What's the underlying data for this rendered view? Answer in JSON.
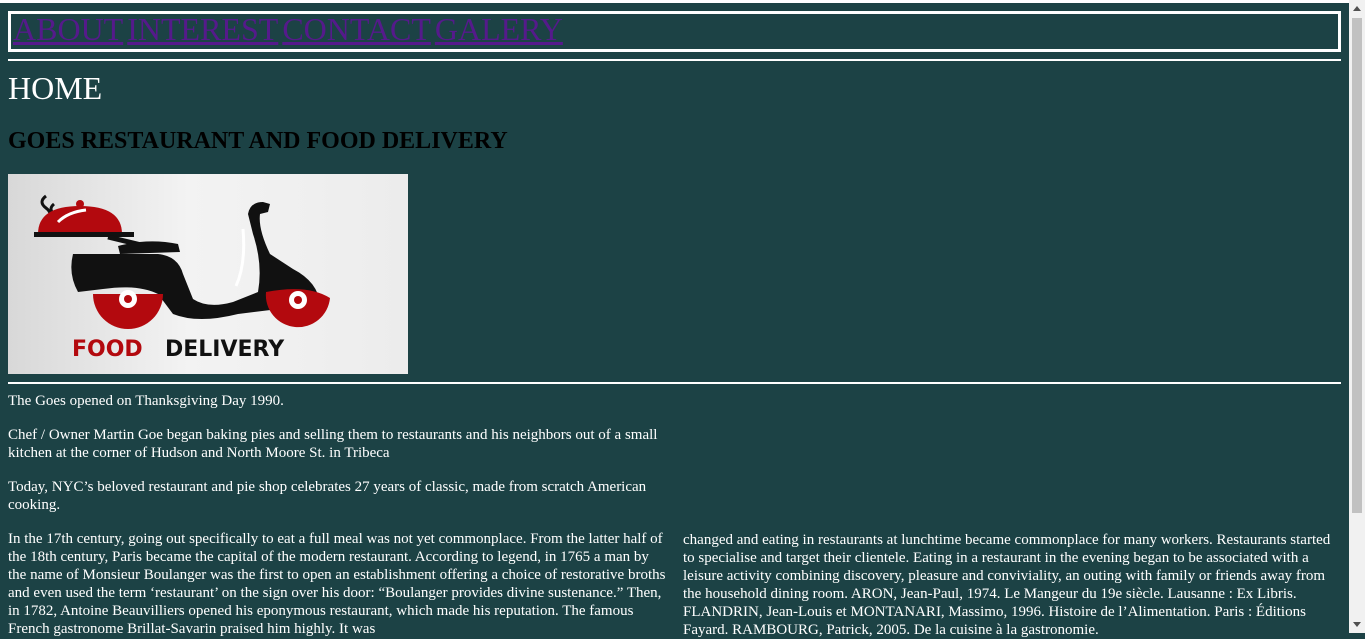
{
  "nav": {
    "links": [
      {
        "label": "ABOUT"
      },
      {
        "label": "INTEREST"
      },
      {
        "label": "CONTACT"
      },
      {
        "label": "GALERY"
      }
    ]
  },
  "headings": {
    "home": "HOME",
    "title": "GOES RESTAURANT AND FOOD DELIVERY"
  },
  "logo": {
    "text": "FOOD DELIVERY",
    "icon": "food-delivery-scooter-icon",
    "colors": {
      "red": "#b3090e",
      "black": "#111111"
    }
  },
  "paragraphs": {
    "p1": "The Goes opened on Thanksgiving Day 1990.",
    "p2": "Chef / Owner Martin Goe began baking pies and selling them to restaurants and his neighbors out of a small kitchen at the corner of Hudson and North Moore St. in Tribeca",
    "p3": "Today, NYC’s beloved restaurant and pie shop celebrates 27 years of classic, made from scratch American cooking.",
    "p4_col1": "In the 17th century, going out specifically to eat a full meal was not yet commonplace. From the latter half of the 18th century, Paris became the capital of the modern restaurant. According to legend, in 1765 a man by the name of Monsieur Boulanger was the first to open an establishment offering a choice of restorative broths and even used the term ‘restaurant’ on the sign over his door: “Boulanger provides divine sustenance.” Then, in 1782, Antoine Beauvilliers opened his eponymous restaurant, which made his reputation. The famous French gastronome Brillat-Savarin praised him highly. It was",
    "p4_col2": "changed and eating in restaurants at lunchtime became commonplace for many workers. Restaurants started to specialise and target their clientele. Eating in a restaurant in the evening began to be associated with a leisure activity combining discovery, pleasure and conviviality, an outing with family or friends away from the household dining room. ARON, Jean-Paul, 1974. Le Mangeur du 19e siècle. Lausanne : Ex Libris. FLANDRIN, Jean-Louis et MONTANARI, Massimo, 1996. Histoire de l’Alimentation. Paris : Éditions Fayard. RAMBOURG, Patrick, 2005. De la cuisine à la gastronomie."
  }
}
